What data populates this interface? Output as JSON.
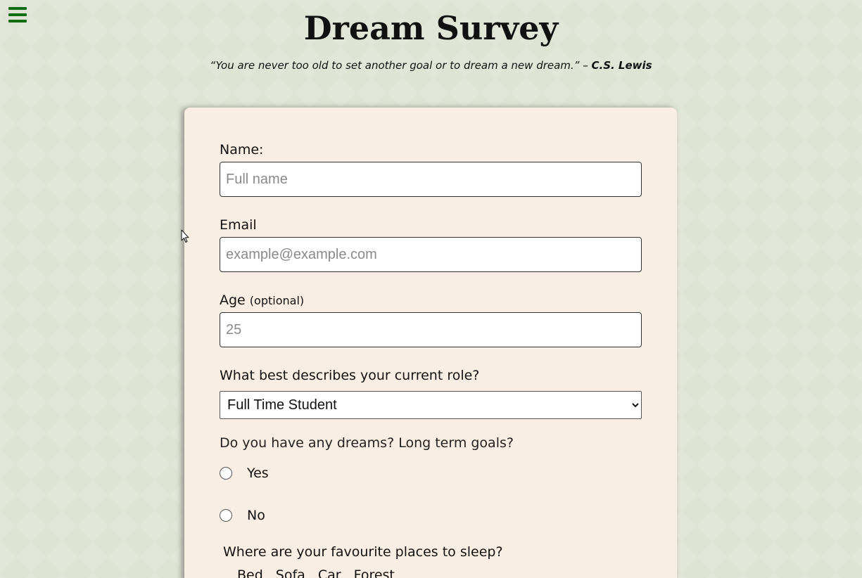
{
  "header": {
    "title": "Dream Survey",
    "quote_text": "“You are never too old to set another goal or to dream a new dream.” – ",
    "quote_author": "C.S. Lewis"
  },
  "form": {
    "name": {
      "label": "Name:",
      "placeholder": "Full name"
    },
    "email": {
      "label": "Email",
      "placeholder": "example@example.com"
    },
    "age": {
      "label": "Age",
      "label_hint": "(optional)",
      "placeholder": "25"
    },
    "role": {
      "label": "What best describes your current role?",
      "selected": "Full Time Student"
    },
    "dreams": {
      "question": "Do you have any dreams? Long term goals?",
      "options": [
        "Yes",
        "No"
      ]
    },
    "places": {
      "question": "Where are your favourite places to sleep?",
      "options": [
        "Bed",
        "Sofa",
        "Car",
        "Forest"
      ]
    }
  },
  "colors": {
    "background": "#dee3d4",
    "card": "#f9eee3",
    "menu_icon": "#0f6b14"
  },
  "icons": {
    "menu": "hamburger-menu-icon",
    "cursor": "mouse-pointer-icon"
  }
}
